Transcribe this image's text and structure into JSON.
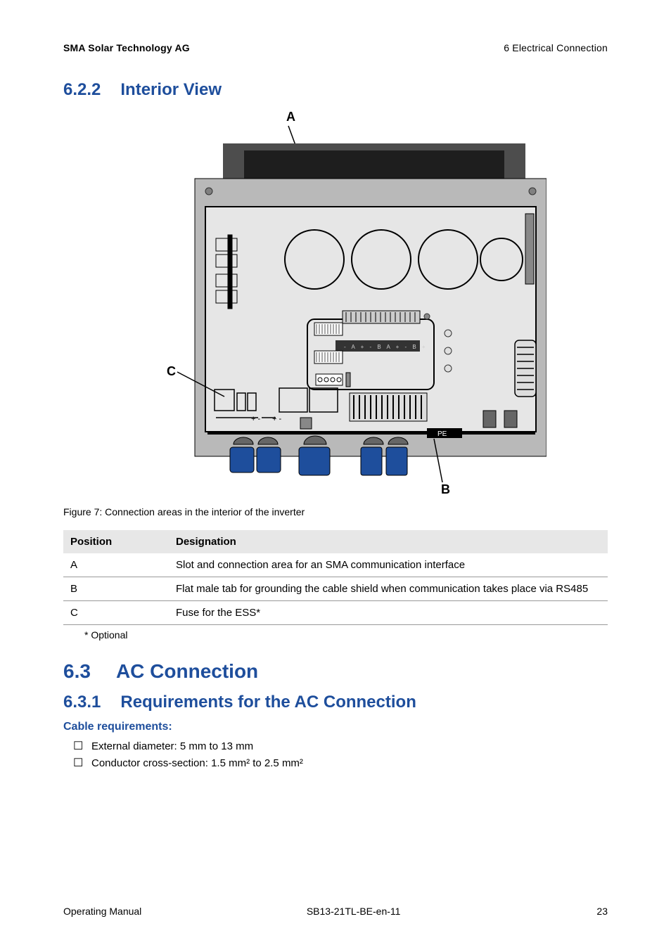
{
  "header": {
    "left": "SMA Solar Technology AG",
    "right": "6 Electrical Connection"
  },
  "sections": {
    "s622": {
      "num": "6.2.2",
      "title": "Interior View"
    },
    "s63": {
      "num": "6.3",
      "title": "AC Connection"
    },
    "s631": {
      "num": "6.3.1",
      "title": "Requirements for the AC Connection"
    }
  },
  "figure": {
    "labels": {
      "a": "A",
      "b": "B",
      "c": "C"
    },
    "caption": "Figure 7: Connection areas in the interior of the inverter",
    "pe_label": "PE"
  },
  "table": {
    "headers": {
      "position": "Position",
      "designation": "Designation"
    },
    "rows": [
      {
        "pos": "A",
        "desig": "Slot and connection area for an SMA communication interface"
      },
      {
        "pos": "B",
        "desig": "Flat male tab for grounding the cable shield when communication takes place via RS485"
      },
      {
        "pos": "C",
        "desig": "Fuse for the ESS*"
      }
    ],
    "footnote": "* Optional"
  },
  "requirements": {
    "heading": "Cable requirements:",
    "items": [
      "External diameter: 5 mm to 13 mm",
      "Conductor cross-section: 1.5 mm² to 2.5 mm²"
    ]
  },
  "footer": {
    "left": "Operating Manual",
    "center": "SB13-21TL-BE-en-11",
    "page": "23"
  }
}
